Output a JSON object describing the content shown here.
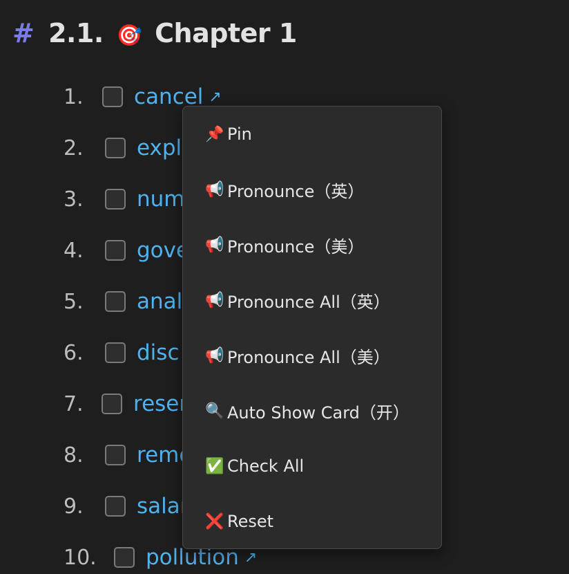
{
  "heading": {
    "hash": "#",
    "number": "2.1.",
    "emoji": "🎯",
    "title": "Chapter 1"
  },
  "list": {
    "items": [
      {
        "index": "1.",
        "word": "cancel",
        "link_icon": "↗"
      },
      {
        "index": "2.",
        "word": "exple"
      },
      {
        "index": "3.",
        "word": "num"
      },
      {
        "index": "4.",
        "word": "gove"
      },
      {
        "index": "5.",
        "word": "analy"
      },
      {
        "index": "6.",
        "word": "disc"
      },
      {
        "index": "7.",
        "word": "reser"
      },
      {
        "index": "8.",
        "word": "remo"
      },
      {
        "index": "9.",
        "word": "salar"
      },
      {
        "index": "10.",
        "word": "pollution",
        "link_icon": "↗"
      }
    ]
  },
  "context_menu": {
    "items": [
      {
        "icon": "📌",
        "icon_name": "pin-icon",
        "label": "Pin"
      },
      {
        "icon": "📢",
        "icon_name": "megaphone-icon",
        "label": "Pronounce（英）"
      },
      {
        "icon": "📢",
        "icon_name": "megaphone-icon",
        "label": "Pronounce（美）"
      },
      {
        "icon": "📢",
        "icon_name": "megaphone-icon",
        "label": "Pronounce All（英）"
      },
      {
        "icon": "📢",
        "icon_name": "megaphone-icon",
        "label": "Pronounce All（美）"
      },
      {
        "icon": "🔍",
        "icon_name": "magnifier-icon",
        "label": "Auto Show Card（开）"
      },
      {
        "icon": "✅",
        "icon_name": "check-mark-icon",
        "label": "Check All"
      },
      {
        "icon": "❌",
        "icon_name": "cross-mark-icon",
        "label": "Reset"
      }
    ]
  },
  "colors": {
    "background": "#1e1e1e",
    "link": "#4fb2ee",
    "hash": "#7a7ae8",
    "menu_bg": "#2b2b2b"
  }
}
